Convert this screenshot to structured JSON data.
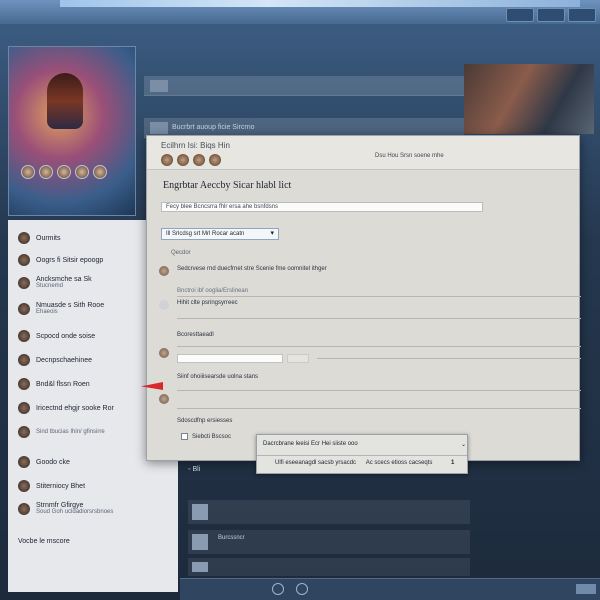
{
  "topbar": {
    "actions": [
      "",
      "",
      ""
    ]
  },
  "hero": {
    "caption": ""
  },
  "bg_strips": [
    {
      "text": ""
    },
    {
      "text": "Bucrbrt auoup ficie Sircrno"
    }
  ],
  "sidebar": {
    "items": [
      {
        "label": "Ourmits",
        "sub": ""
      },
      {
        "label": "Oogrs fi Sitsir epoogp",
        "sub": ""
      },
      {
        "label": "Ancksmche sa Sk",
        "sub": "Stucnemd"
      },
      {
        "label": "Nmuasde s Sith Rooe",
        "sub": "Ehaeois"
      },
      {
        "label": "Scpocd onde soise",
        "sub": ""
      },
      {
        "label": "Decnpschaehinee",
        "sub": ""
      },
      {
        "label": "Bnd&l flssn Roen",
        "sub": ""
      },
      {
        "label": "Iricectnd ehgjr sooke Ror",
        "sub": ""
      },
      {
        "label": "",
        "sub": "Sind tbucias Ihin/ gfinsirre"
      },
      {
        "label": "Goodo cke",
        "sub": ""
      },
      {
        "label": "Stiterniocy Bhet",
        "sub": ""
      },
      {
        "label": "Strnmfr Gfirgye",
        "sub": "Soud Goh ucldadiorsrsbnoes"
      },
      {
        "label": "Vocbe le mscore",
        "sub": ""
      }
    ]
  },
  "dialog": {
    "title_small": "Ecilhrn Isi: Biqs Hin",
    "header_right_1": "Dsu Hou Srsn soene mhe",
    "header_right_2": "",
    "heading": "Engrbtar Aeccby Sicar hlabl lict",
    "input_a_value": "Fecy blee Bcncsrra fhlr ersa ahe bsnfdsns",
    "select_a_value": "Ill Srlcdsg srt Mrl Rocar acatn",
    "section_label": "Qecdor",
    "rows": [
      {
        "title": "Sedcrvese rnd duecfrnet stre Scenie fme oomnitel ithger",
        "sub": ""
      },
      {
        "title": "",
        "sub": "Bnctroi ibf ooglia/Erslinean"
      },
      {
        "title": "Hihit clte psringsyrreec",
        "sub": ""
      },
      {
        "title": "Bcoresttaeadl",
        "sub": ""
      },
      {
        "title": "Siinf ohoiiisearsde uolna stans",
        "sub": ""
      },
      {
        "title": "Sdoscdfnp ersiesses",
        "sub": ""
      }
    ],
    "checkbox_label": "Siebcti Bscsoc"
  },
  "popup": {
    "line1": "Dacrcbrane leeisi Ecr Hei siiste ooo",
    "line2": "Ulfi eseeanagdl sacsb yrsacdc",
    "line2b": "Ac scecs etioss cacseqts",
    "num": "1"
  },
  "feed": {
    "head": "Bli",
    "rows": [
      {
        "title": "",
        "sub": ""
      },
      {
        "title": "Burcssncr",
        "sub": ""
      },
      {
        "title": "",
        "sub": ""
      }
    ]
  }
}
